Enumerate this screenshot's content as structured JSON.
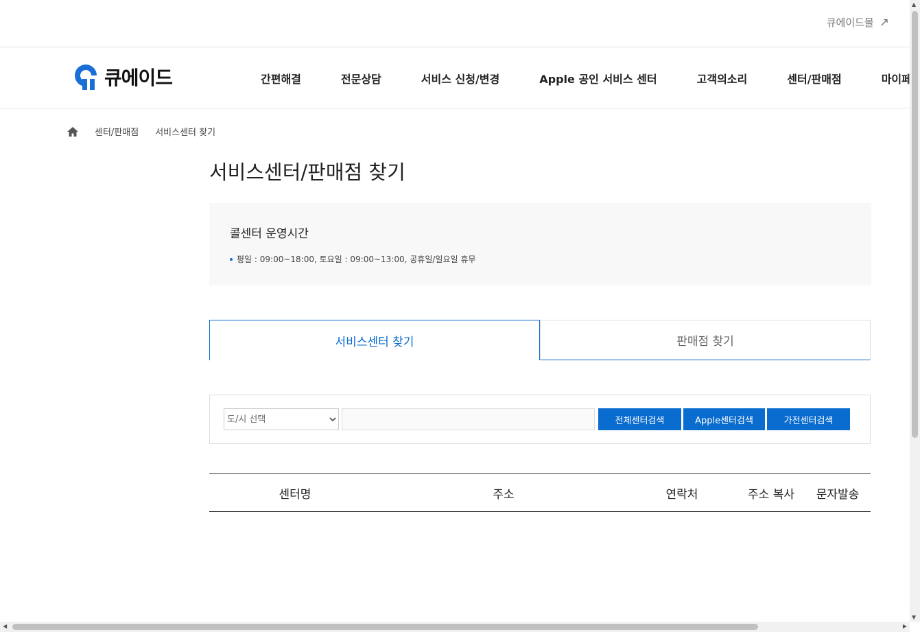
{
  "util": {
    "mall_label": "큐에이드몰",
    "mall_icon": "external-arrow-icon"
  },
  "header": {
    "logo_text": "큐에이드",
    "nav": [
      "간편해결",
      "전문상담",
      "서비스 신청/변경",
      "Apple 공인 서비스 센터",
      "고객의소리",
      "센터/판매점",
      "마이페이지"
    ]
  },
  "breadcrumb": {
    "items": [
      "센터/판매점",
      "서비스센터 찾기"
    ]
  },
  "page_title": "서비스센터/판매점 찾기",
  "info": {
    "title": "콜센터 운영시간",
    "line": "평일 : 09:00~18:00, 토요일 : 09:00~13:00, 공휴일/일요일 휴무"
  },
  "tabs": [
    {
      "label": "서비스센터 찾기",
      "active": true
    },
    {
      "label": "판매점 찾기",
      "active": false
    }
  ],
  "search": {
    "city_selected": "도/시 선택",
    "keyword_value": "",
    "btn_all": "전체센터검색",
    "btn_apple": "Apple센터검색",
    "btn_home": "가전센터검색"
  },
  "table": {
    "columns": [
      "센터명",
      "주소",
      "연락처",
      "주소 복사",
      "문자발송"
    ]
  },
  "colors": {
    "accent": "#0a6ccf"
  }
}
